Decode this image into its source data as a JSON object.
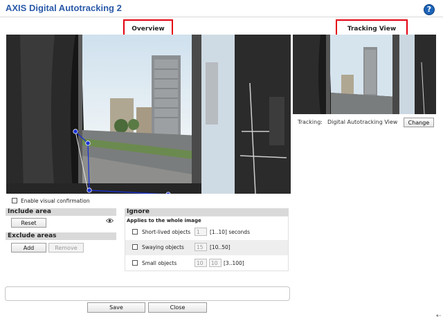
{
  "header": {
    "title": "AXIS Digital Autotracking 2",
    "help_icon": "?"
  },
  "overview": {
    "heading": "Overview",
    "enable_visual_confirmation": "Enable visual confirmation"
  },
  "tracking": {
    "heading": "Tracking View",
    "label": "Tracking:",
    "value": "Digital Autotracking View",
    "change_button": "Change"
  },
  "include_area": {
    "heading": "Include area",
    "reset_button": "Reset"
  },
  "exclude_areas": {
    "heading": "Exclude areas",
    "add_button": "Add",
    "remove_button": "Remove"
  },
  "ignore": {
    "heading": "Ignore",
    "subheading": "Applies to the whole image",
    "rows": [
      {
        "label": "Short-lived objects",
        "inputs": [
          "1"
        ],
        "range": "[1..10] seconds"
      },
      {
        "label": "Swaying objects",
        "inputs": [
          "15"
        ],
        "range": "[10..50]"
      },
      {
        "label": "Small objects",
        "inputs": [
          "10",
          "10"
        ],
        "range": "[3..100]"
      }
    ]
  },
  "footer": {
    "save_button": "Save",
    "close_button": "Close"
  },
  "colors": {
    "title": "#2a5aa8",
    "highlight_border": "#e3000f",
    "polygon": "#1a32d6"
  }
}
